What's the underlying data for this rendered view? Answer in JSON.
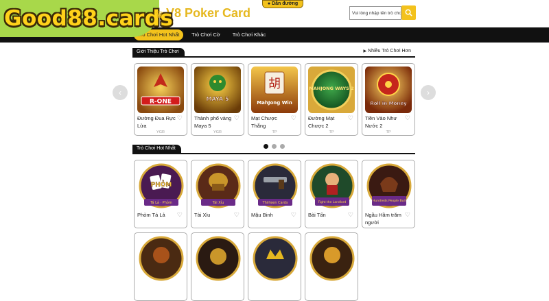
{
  "header": {
    "brand": "Good88.cards",
    "title": "V8 Poker Card",
    "directions_label": "Dẫn đường",
    "search": {
      "placeholder": "Vui lòng nhập tên trò chơi."
    }
  },
  "nav": {
    "tabs": [
      {
        "label": "Trò Chơi Hot Nhất",
        "active": true
      },
      {
        "label": "Trò Chơi Cờ",
        "active": false
      },
      {
        "label": "Trò Chơi Khác",
        "active": false
      }
    ]
  },
  "intro": {
    "label": "Giới Thiệu Trò Chơi",
    "more_label": "Nhiều Trò Chơi Hơn",
    "cards": [
      {
        "name": "Đường Đua Rực Lửa",
        "provider": "YGR",
        "art": "R-ONE"
      },
      {
        "name": "Thành phố vàng Maya 5",
        "provider": "YGR",
        "art": "MAYA 5"
      },
      {
        "name": "Mạt Chược Thắng",
        "provider": "TP",
        "art": "MahJong Win"
      },
      {
        "name": "Đường Mạt Chược 2",
        "provider": "TP",
        "art": "MAHJONG WAYS 2"
      },
      {
        "name": "Tiền Vào Như Nước 2",
        "provider": "TP",
        "art": "Roll in Money"
      }
    ],
    "pager": {
      "count": 3,
      "active": 1
    }
  },
  "hot": {
    "label": "Trò Chơi Hot Nhất",
    "cards": [
      {
        "name": "Phỏm Tá Lả",
        "ribbon": "Tá Lả · Phỏm",
        "art": "PHỎM"
      },
      {
        "name": "Tài Xỉu",
        "ribbon": "Tài Xỉu",
        "art": ""
      },
      {
        "name": "Mậu Binh",
        "ribbon": "Thirteen Cards",
        "art": ""
      },
      {
        "name": "Bài Tấn",
        "ribbon": "Fight the Landlord",
        "art": ""
      },
      {
        "name": "Ngầu Hầm trăm người",
        "ribbon": "Hundreds People Bull",
        "art": ""
      },
      {
        "name": "",
        "ribbon": "",
        "art": ""
      },
      {
        "name": "",
        "ribbon": "",
        "art": ""
      },
      {
        "name": "",
        "ribbon": "",
        "art": ""
      },
      {
        "name": "",
        "ribbon": "",
        "art": ""
      }
    ]
  },
  "colors": {
    "accent": "#f3c21c",
    "brand_bg": "#a8d84a",
    "nav_bg": "#111111"
  }
}
